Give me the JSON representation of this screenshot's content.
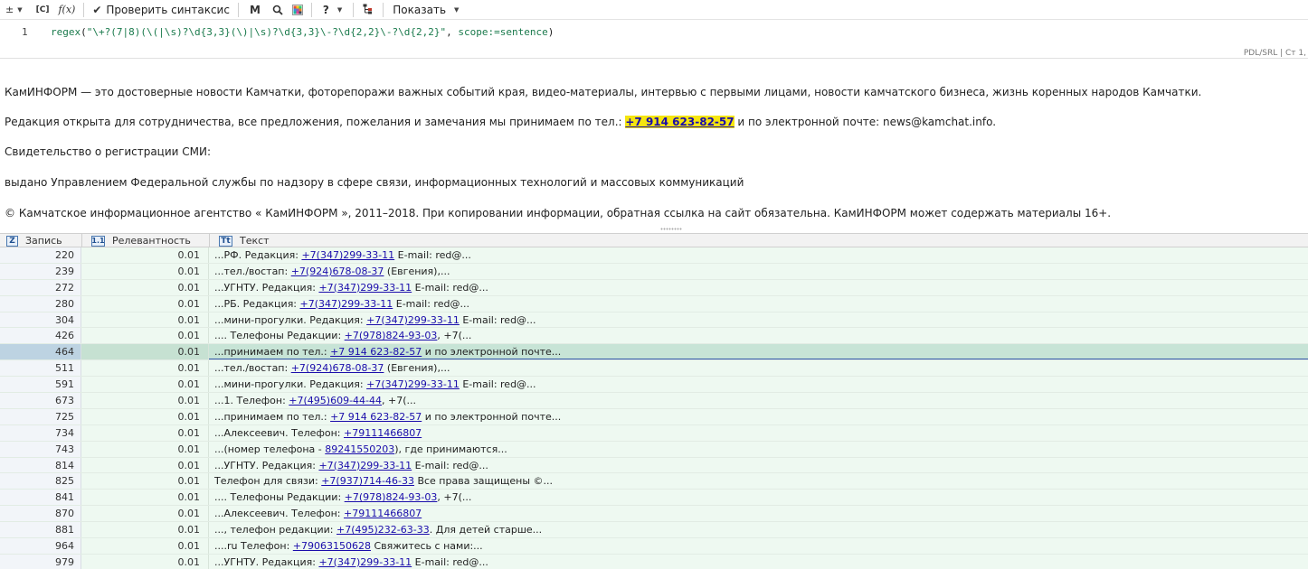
{
  "toolbar": {
    "items": [
      {
        "glyph": "±",
        "has_menu": true
      },
      {
        "glyph": "[C]",
        "has_menu": false
      },
      {
        "glyph": "f(x)",
        "has_menu": false
      }
    ],
    "check_syntax_label": "Проверить синтаксис",
    "bold_glyph": "M",
    "help_glyph": "?",
    "show_label": "Показать"
  },
  "editor": {
    "line_number": "1",
    "code_fn": "regex",
    "code_open": "(",
    "code_string": "\"\\+?(7|8)(\\(|\\s)?\\d{3,3}(\\)|\\s)?\\d{3,3}\\-?\\d{2,2}\\-?\\d{2,2}\"",
    "code_sep": ", ",
    "code_param": "scope:=sentence",
    "code_close": ")",
    "status": "PDL/SRL | Ст 1,"
  },
  "preview": {
    "p1": "КамИНФОРМ — это достоверные новости Камчатки, фоторепоражи важных событий края, видео-материалы, интервью с первыми лицами, новости камчатского бизнеса, жизнь коренных народов Камчатки.",
    "p2_before": "Редакция открыта для сотрудничества, все предложения, пожелания и замечания мы принимаем по тел.: ",
    "p2_highlight": "+7 914 623-82-57",
    "p2_after": " и по электронной почте: news@kamchat.info.",
    "p3": "Свидетельство о регистрации СМИ:",
    "p4": "выдано Управлением Федеральной службы по надзору в сфере связи, информационных технологий и массовых коммуникаций",
    "p5": "© Камчатское информационное агентство « КамИНФОРМ », 2011–2018. При копировании информации, обратная ссылка на сайт обязательна. КамИНФОРМ может содержать материалы 16+."
  },
  "grid": {
    "columns": [
      {
        "icon": "Z",
        "label": "Запись"
      },
      {
        "icon": "1.1",
        "label": "Релевантность"
      },
      {
        "icon": "Tt",
        "label": "Текст"
      }
    ],
    "selected_index": 6,
    "rows": [
      {
        "rec": "220",
        "rel": "0.01",
        "pre": "...РФ. Редакция: ",
        "link": "+7(347)299-33-11",
        "post": " E-mail: red@..."
      },
      {
        "rec": "239",
        "rel": "0.01",
        "pre": "...тел./востап:  ",
        "link": "+7(924)678-08-37",
        "post": " (Евгения),..."
      },
      {
        "rec": "272",
        "rel": "0.01",
        "pre": "...УГНТУ. Редакция: ",
        "link": "+7(347)299-33-11",
        "post": " E-mail: red@..."
      },
      {
        "rec": "280",
        "rel": "0.01",
        "pre": "...РБ. Редакция: ",
        "link": "+7(347)299-33-11",
        "post": " E-mail: red@..."
      },
      {
        "rec": "304",
        "rel": "0.01",
        "pre": "...мини-прогулки. Редакция: ",
        "link": "+7(347)299-33-11",
        "post": " E-mail: red@..."
      },
      {
        "rec": "426",
        "rel": "0.01",
        "pre": ".... Телефоны Редакции: ",
        "link": "+7(978)824-93-03",
        "post": ", +7(..."
      },
      {
        "rec": "464",
        "rel": "0.01",
        "pre": "...принимаем по тел.: ",
        "link": "+7 914 623-82-57",
        "post": " и по электронной почте..."
      },
      {
        "rec": "511",
        "rel": "0.01",
        "pre": "...тел./востап:  ",
        "link": "+7(924)678-08-37",
        "post": " (Евгения),..."
      },
      {
        "rec": "591",
        "rel": "0.01",
        "pre": "...мини-прогулки. Редакция: ",
        "link": "+7(347)299-33-11",
        "post": " E-mail: red@..."
      },
      {
        "rec": "673",
        "rel": "0.01",
        "pre": "...1. Телефон: ",
        "link": "+7(495)609-44-44",
        "post": ", +7(..."
      },
      {
        "rec": "725",
        "rel": "0.01",
        "pre": "...принимаем по тел.: ",
        "link": "+7 914 623-82-57",
        "post": " и по электронной почте..."
      },
      {
        "rec": "734",
        "rel": "0.01",
        "pre": "...Алексеевич. Телефон: ",
        "link": "+79111466807",
        "post": ""
      },
      {
        "rec": "743",
        "rel": "0.01",
        "pre": "...(номер телефона - ",
        "link": "89241550203",
        "post": "), где принимаются..."
      },
      {
        "rec": "814",
        "rel": "0.01",
        "pre": "...УГНТУ. Редакция: ",
        "link": "+7(347)299-33-11",
        "post": " E-mail: red@..."
      },
      {
        "rec": "825",
        "rel": "0.01",
        "pre": "Телефон для связи: ",
        "link": "+7(937)714-46-33",
        "post": " Все права защищены ©..."
      },
      {
        "rec": "841",
        "rel": "0.01",
        "pre": ".... Телефоны Редакции: ",
        "link": "+7(978)824-93-03",
        "post": ", +7(..."
      },
      {
        "rec": "870",
        "rel": "0.01",
        "pre": "...Алексеевич. Телефон: ",
        "link": "+79111466807",
        "post": ""
      },
      {
        "rec": "881",
        "rel": "0.01",
        "pre": "..., телефон редакции: ",
        "link": "+7(495)232-63-33",
        "post": ". Для детей старше..."
      },
      {
        "rec": "964",
        "rel": "0.01",
        "pre": "....ru Телефон: ",
        "link": "+79063150628",
        "post": " Свяжитесь с нами:..."
      },
      {
        "rec": "979",
        "rel": "0.01",
        "pre": "...УГНТУ. Редакция: ",
        "link": "+7(347)299-33-11",
        "post": " E-mail: red@..."
      }
    ]
  }
}
